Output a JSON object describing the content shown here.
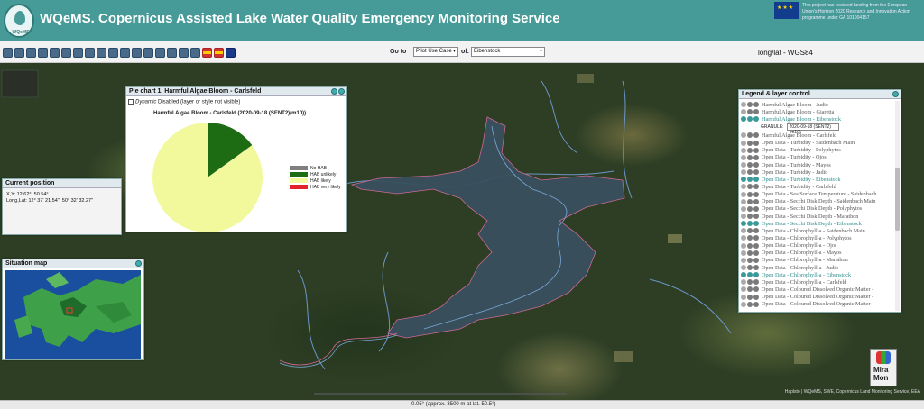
{
  "header": {
    "logo_text": "WQeMS",
    "title": "WQeMS. Copernicus Assisted Lake Water Quality Emergency Monitoring Service",
    "eu_note": "This project has received funding from the European Union's Horizon 2020 Research and Innovation Action programme under GA 101004157"
  },
  "toolbar": {
    "goto_label": "Go to",
    "goto_value": "Pilot Use Case",
    "of_label": "of:",
    "of_value": "Eibenstock",
    "projection": "long/lat - WGS84"
  },
  "pie_panel": {
    "title": "Pie chart 1, Harmful Algae Bloom - Carlsfeld",
    "dynamic_label": "Dynamic",
    "dynamic_status": "Disabled (layer or style not visible)",
    "chart_title": "Harmful Algae Bloom - Carlsfeld (2020-09-18 (SENT2)(m10))"
  },
  "chart_data": {
    "type": "pie",
    "title": "Harmful Algae Bloom - Carlsfeld (2020-09-18 (SENT2)(m10))",
    "categories": [
      "No HAB",
      "HAB unlikely",
      "HAB likely",
      "HAB very likely"
    ],
    "values": [
      0,
      15,
      85,
      0
    ],
    "colors": [
      "#7f7f7f",
      "#1d6b12",
      "#f2f99c",
      "#e3232b"
    ],
    "legend_position": "right"
  },
  "position_panel": {
    "title": "Current position",
    "xy": "X,Y: 12.62°, 50.54°",
    "longlat": "Long,Lat: 12° 37' 21.54\", 50° 32' 32.27\""
  },
  "situation_panel": {
    "title": "Situation map"
  },
  "layers_panel": {
    "title": "Legend & layer control",
    "granule_label": "GRANULE:",
    "granule_value": "2020-09-18 (SENT2)(m10)",
    "layers_before": [
      {
        "label": "Harmful Algae Bloom - Judio",
        "active": false
      },
      {
        "label": "Harmful Algae Bloom - Giaretta",
        "active": false
      },
      {
        "label": "Harmful Algae Bloom - Eibenstock",
        "active": true
      }
    ],
    "layers_after": [
      {
        "label": "Harmful Algae Bloom - Carlsfeld",
        "active": false
      },
      {
        "label": "Open Data - Turbidity - Saidenbach Main",
        "active": false
      },
      {
        "label": "Open Data - Turbidity - Polyphytos",
        "active": false
      },
      {
        "label": "Open Data - Turbidity - Ojos",
        "active": false
      },
      {
        "label": "Open Data - Turbidity - Mayos",
        "active": false
      },
      {
        "label": "Open Data - Turbidity - Judio",
        "active": false
      },
      {
        "label": "Open Data - Turbidity - Eibenstock",
        "active": true
      },
      {
        "label": "Open Data - Turbidity - Carlsfeld",
        "active": false
      },
      {
        "label": "Open Data - Sea Surface Temperature - Saidenbach",
        "active": false
      },
      {
        "label": "Open Data - Secchi Disk Depth - Saidenbach Main",
        "active": false
      },
      {
        "label": "Open Data - Secchi Disk Depth - Polyphytos",
        "active": false
      },
      {
        "label": "Open Data - Secchi Disk Depth - Marathon",
        "active": false
      },
      {
        "label": "Open Data - Secchi Disk Depth - Eibenstock",
        "active": true
      },
      {
        "label": "Open Data - Chlorophyll-a - Saidenbach Main",
        "active": false
      },
      {
        "label": "Open Data - Chlorophyll-a - Polyphytos",
        "active": false
      },
      {
        "label": "Open Data - Chlorophyll-a - Ojos",
        "active": false
      },
      {
        "label": "Open Data - Chlorophyll-a - Mayos",
        "active": false
      },
      {
        "label": "Open Data - Chlorophyll-a - Marathon",
        "active": false
      },
      {
        "label": "Open Data - Chlorophyll-a - Judio",
        "active": false
      },
      {
        "label": "Open Data - Chlorophyll-a - Eibenstock",
        "active": true
      },
      {
        "label": "Open Data - Chlorophyll-a - Carlsfeld",
        "active": false
      },
      {
        "label": "Open Data - Coloured Dissolved Organic Matter -",
        "active": false
      },
      {
        "label": "Open Data - Coloured Dissolved Organic Matter -",
        "active": false
      },
      {
        "label": "Open Data - Coloured Dissolved Organic Matter -",
        "active": false
      }
    ]
  },
  "map": {
    "scale_text": "0.05° (approx. 3500 m at lat. 50.5°)",
    "attribution": "Haplsto | WQeMS, SWE, Copernicus Land Monitoring Service, EEA",
    "miramon_text": "Mira Mon"
  }
}
